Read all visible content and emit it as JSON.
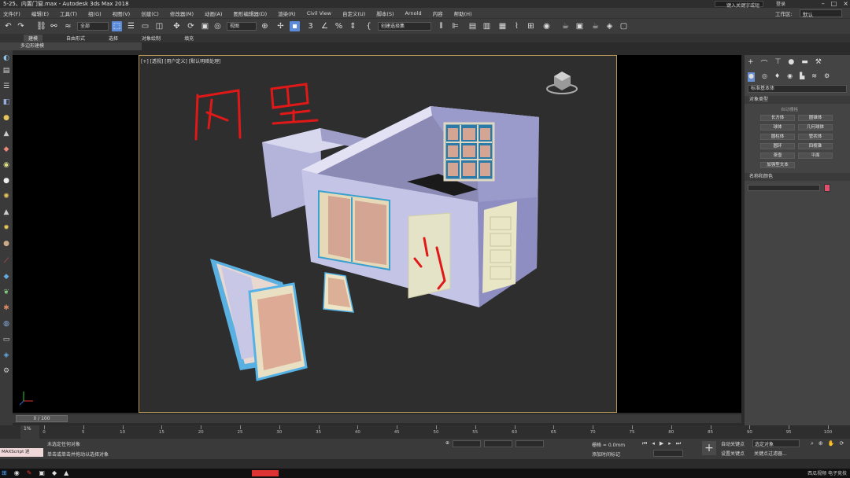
{
  "title": "5-25、内置门窗.max - Autodesk 3ds Max 2018",
  "search_placeholder": "键入关键字或短语",
  "account": "登录",
  "menu": [
    "文件(F)",
    "编辑(E)",
    "工具(T)",
    "组(G)",
    "视图(V)",
    "创建(C)",
    "修改器(M)",
    "动画(A)",
    "图形编辑器(D)",
    "渲染(R)",
    "Civil View",
    "自定义(U)",
    "脚本(S)",
    "Arnold",
    "内容",
    "帮助(H)"
  ],
  "workspace_label": "工作区:",
  "workspace_value": "默认",
  "toolbar": {
    "selection_filter": "全部",
    "reference_coord": "视图",
    "named_selection": "创建选择集"
  },
  "ribbon_tabs": [
    "建模",
    "自由形式",
    "选择",
    "对象绘制",
    "填充"
  ],
  "ribbon_sub": "多边形建模",
  "viewport_label": "[+] [透视] [用户定义] [默认明暗处理]",
  "annotations": {
    "top": "内置",
    "door": "门"
  },
  "command_panel": {
    "category_dropdown": "标准基本体",
    "object_type_header": "对象类型",
    "autogrid": "自动栅格",
    "buttons": [
      "长方体",
      "圆锥体",
      "球体",
      "几何球体",
      "圆柱体",
      "管状体",
      "圆环",
      "四棱锥",
      "茶壶",
      "平面"
    ],
    "extra_button": "加强型文本",
    "name_color_header": "名称和颜色",
    "swatch_color": "#e0506e"
  },
  "timeslider": "0 / 100",
  "timeline_ticks": [
    0,
    5,
    10,
    15,
    20,
    25,
    30,
    35,
    40,
    45,
    50,
    55,
    60,
    65,
    70,
    75,
    80,
    85,
    90,
    95,
    100
  ],
  "status": {
    "maxscript": "MAXScript 迷",
    "line1": "未选定任何对象",
    "line2": "单击或单击并拖动以选择对象",
    "grid": "栅格 = 0.0mm",
    "add_time_tag": "添加时间标记",
    "auto_key": "自动关键点",
    "set_key": "设置关键点",
    "selected": "选定对象",
    "key_filters": "关键点过滤器..."
  },
  "taskbar_right": "西瓜视频 电子竞技"
}
